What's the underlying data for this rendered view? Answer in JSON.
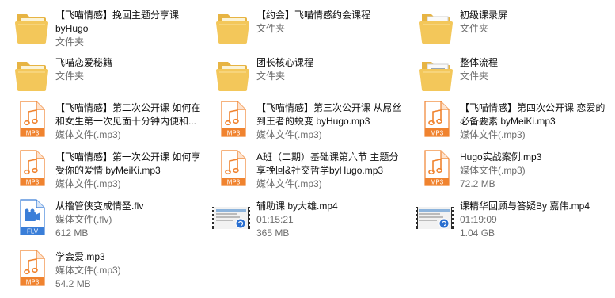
{
  "items": [
    {
      "name": "【飞喵情感】挽回主题分享课byHugo",
      "sub": [
        "文件夹"
      ],
      "icon": "folder-icon"
    },
    {
      "name": "【约会】飞喵情感约会课程",
      "sub": [
        "文件夹"
      ],
      "icon": "folder-icon"
    },
    {
      "name": "初级课录屏",
      "sub": [
        "文件夹"
      ],
      "icon": "folder-with-documents-icon"
    },
    {
      "name": "飞喵恋爱秘籍",
      "sub": [
        "文件夹"
      ],
      "icon": "folder-icon"
    },
    {
      "name": "团长核心课程",
      "sub": [
        "文件夹"
      ],
      "icon": "folder-icon"
    },
    {
      "name": "整体流程",
      "sub": [
        "文件夹"
      ],
      "icon": "folder-with-documents-icon"
    },
    {
      "name": "【飞喵情感】第二次公开课 如何在和女生第一次见面十分钟内便和...",
      "sub": [],
      "icon": "mp3-file-icon"
    },
    {
      "name": "【飞喵情感】第三次公开课 从屌丝到王者的蜕变 byHugo.mp3",
      "sub": [],
      "icon": "mp3-file-icon"
    },
    {
      "name": "【飞喵情感】第四次公开课 恋爱的必备要素 byMeiKi.mp3",
      "sub": [],
      "icon": "mp3-file-icon"
    },
    {
      "name": "【飞喵情感】第一次公开课 如何享受你的爱情 byMeiKi.mp3",
      "sub": [],
      "icon": "mp3-file-icon"
    },
    {
      "name": "A班（二期）基础课第六节  主题分享挽回&社交哲学byHugo.mp3",
      "sub": [],
      "icon": "mp3-file-icon"
    },
    {
      "name": "Hugo实战案例.mp3",
      "sub": [
        "媒体文件(.mp3)",
        "72.2 MB"
      ],
      "icon": "mp3-file-icon"
    },
    {
      "name": "从撸管侠变成情圣.flv",
      "sub": [
        "媒体文件(.flv)",
        "612 MB"
      ],
      "icon": "flv-file-icon"
    },
    {
      "name": "辅助课   by大雄.mp4",
      "sub": [
        "01:15:21",
        "365 MB"
      ],
      "icon": "video-thumbnail-icon"
    },
    {
      "name": "课精华回顾与答疑By 嘉伟.mp4",
      "sub": [
        "01:19:09",
        "1.04 GB"
      ],
      "icon": "video-thumbnail-icon"
    },
    {
      "name": "学会爱.mp3",
      "sub": [
        "媒体文件(.mp3)",
        "54.2 MB"
      ],
      "icon": "mp3-file-icon"
    }
  ],
  "labels": {
    "mp3": "MP3",
    "flv": "FLV",
    "mp3_type": "媒体文件(.mp3)"
  },
  "colors": {
    "mp3_accent": "#f0832f",
    "flv_accent": "#3a7ed8",
    "folder": "#f3c75a"
  }
}
